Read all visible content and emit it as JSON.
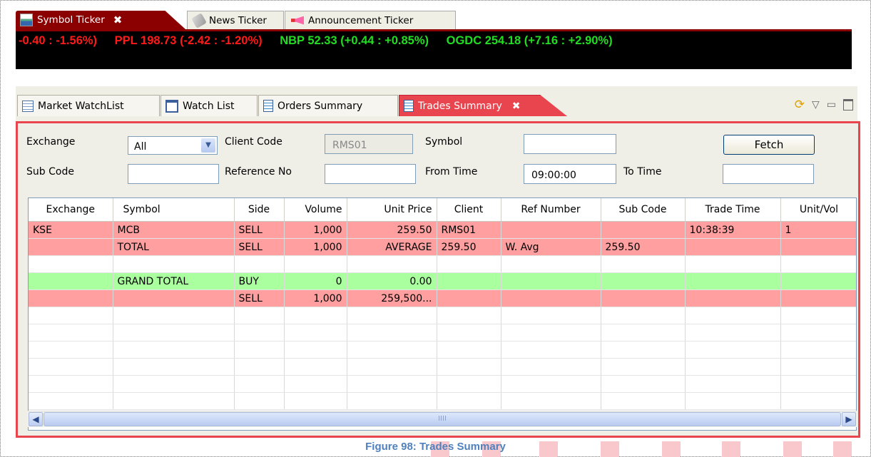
{
  "ticker_tabs": [
    {
      "label": "Symbol Ticker",
      "icon": "chart-icon",
      "active": true
    },
    {
      "label": "News Ticker",
      "icon": "news-icon"
    },
    {
      "label": "Announcement Ticker",
      "icon": "megaphone-icon"
    }
  ],
  "ticker": [
    {
      "text": "-0.40 : -1.56%)",
      "trend": "neg"
    },
    {
      "text": "PPL  198.73 (-2.42 : -1.20%)",
      "trend": "neg"
    },
    {
      "text": "NBP  52.33 (+0.44 : +0.85%)",
      "trend": "pos"
    },
    {
      "text": "OGDC  254.18 (+7.16 : +2.90%)",
      "trend": "pos"
    }
  ],
  "tabs": [
    {
      "label": "Market WatchList",
      "icon": "table-icon"
    },
    {
      "label": "Watch List",
      "icon": "window-icon"
    },
    {
      "label": "Orders Summary",
      "icon": "document-icon"
    },
    {
      "label": "Trades Summary",
      "icon": "document-icon",
      "active": true
    }
  ],
  "filters": {
    "exchange_label": "Exchange",
    "exchange_value": "All",
    "client_code_label": "Client Code",
    "client_code_value": "RMS01",
    "symbol_label": "Symbol",
    "symbol_value": "",
    "fetch_label": "Fetch",
    "sub_code_label": "Sub Code",
    "sub_code_value": "",
    "reference_no_label": "Reference No",
    "reference_no_value": "",
    "from_time_label": "From Time",
    "from_time_value": "09:00:00",
    "to_time_label": "To Time",
    "to_time_value": ""
  },
  "table": {
    "columns": [
      "Exchange",
      "Symbol",
      "Side",
      "Volume",
      "Unit Price",
      "Client",
      "Ref Number",
      "Sub Code",
      "Trade Time",
      "Unit/Vol"
    ],
    "rows": [
      {
        "style": "red",
        "cells": [
          "KSE",
          "MCB",
          "SELL",
          "1,000",
          "259.50",
          "RMS01",
          "",
          "",
          "10:38:39",
          "1"
        ]
      },
      {
        "style": "red",
        "cells": [
          "",
          "TOTAL",
          "SELL",
          "1,000",
          "AVERAGE",
          "259.50",
          "W. Avg",
          "259.50",
          "",
          ""
        ]
      },
      {
        "style": "white",
        "cells": [
          "",
          "",
          "",
          "",
          "",
          "",
          "",
          "",
          "",
          ""
        ]
      },
      {
        "style": "green",
        "cells": [
          "",
          "GRAND TOTAL",
          "BUY",
          "0",
          "0.00",
          "",
          "",
          "",
          "",
          ""
        ]
      },
      {
        "style": "red",
        "cells": [
          "",
          "",
          "SELL",
          "1,000",
          "259,500...",
          "",
          "",
          "",
          "",
          ""
        ]
      },
      {
        "style": "white",
        "cells": [
          "",
          "",
          "",
          "",
          "",
          "",
          "",
          "",
          "",
          ""
        ]
      },
      {
        "style": "white",
        "cells": [
          "",
          "",
          "",
          "",
          "",
          "",
          "",
          "",
          "",
          ""
        ]
      },
      {
        "style": "white",
        "cells": [
          "",
          "",
          "",
          "",
          "",
          "",
          "",
          "",
          "",
          ""
        ]
      },
      {
        "style": "white",
        "cells": [
          "",
          "",
          "",
          "",
          "",
          "",
          "",
          "",
          "",
          ""
        ]
      },
      {
        "style": "white",
        "cells": [
          "",
          "",
          "",
          "",
          "",
          "",
          "",
          "",
          "",
          ""
        ]
      },
      {
        "style": "white",
        "cells": [
          "",
          "",
          "",
          "",
          "",
          "",
          "",
          "",
          "",
          ""
        ]
      }
    ]
  },
  "scrollbar_grip": "IIII",
  "caption": "Figure 98: Trades Summary",
  "colors": {
    "active_tab": "#e8454f",
    "sell_row": "#ff9f9f",
    "buy_row": "#aaff9f",
    "caption": "#4f81bd"
  }
}
